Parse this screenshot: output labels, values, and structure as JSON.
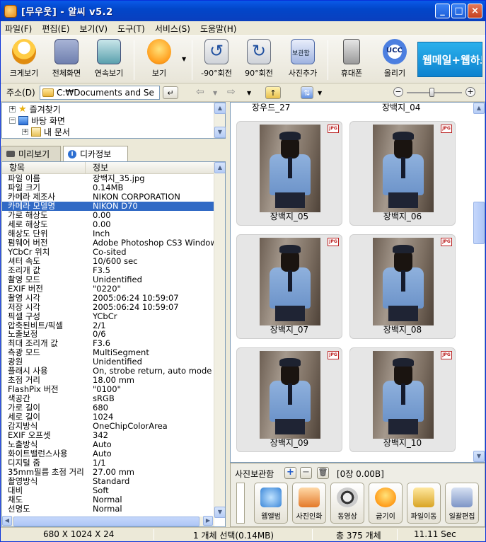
{
  "window": {
    "title": "[무우웃] - 알씨 v5.2",
    "controls": [
      "_",
      "□",
      "×"
    ]
  },
  "menu": [
    "파일(F)",
    "편집(E)",
    "보기(V)",
    "도구(T)",
    "서비스(S)",
    "도움말(H)"
  ],
  "toolbar": {
    "items": [
      {
        "label": "크게보기",
        "icon": "penguin-icon"
      },
      {
        "label": "전체화면",
        "icon": "robot-icon"
      },
      {
        "label": "연속보기",
        "icon": "slideshow-icon"
      },
      {
        "label": "보기",
        "icon": "owl-icon"
      },
      {
        "label": "-90°회전",
        "icon": "rotate-left-icon"
      },
      {
        "label": "90°회전",
        "icon": "rotate-right-icon"
      },
      {
        "label": "사진추가",
        "icon": "album-icon"
      },
      {
        "label": "휴대폰",
        "icon": "phone-icon"
      },
      {
        "label": "올리기",
        "icon": "ucc-icon"
      }
    ],
    "banner": "웹메일+웹하드"
  },
  "address": {
    "label": "주소(D)",
    "value": "C:₩Documents and Se"
  },
  "tree": [
    {
      "label": "즐겨찾기",
      "expander": "+"
    },
    {
      "label": "바탕 화면",
      "expander": "−"
    },
    {
      "label": "내 문서",
      "expander": "+"
    }
  ],
  "tabs": {
    "preview": "미리보기",
    "exif": "디카정보"
  },
  "exif": {
    "headers": [
      "항목",
      "정보"
    ],
    "rows": [
      {
        "k": "파일 이름",
        "v": "장백지_35.jpg"
      },
      {
        "k": "파일 크기",
        "v": "0.14MB"
      },
      {
        "k": "카메라 제조사",
        "v": "NIKON CORPORATION"
      },
      {
        "k": "카메라 모델명",
        "v": "NIKON D70",
        "selected": true
      },
      {
        "k": "가로 해상도",
        "v": "0.00"
      },
      {
        "k": "세로 해상도",
        "v": "0.00"
      },
      {
        "k": "해상도 단위",
        "v": "Inch"
      },
      {
        "k": "펌웨어 버전",
        "v": "Adobe Photoshop CS3 Windows"
      },
      {
        "k": "YCbCr 위치",
        "v": "Co-sited"
      },
      {
        "k": "셔터 속도",
        "v": "10/600 sec"
      },
      {
        "k": "조리개 값",
        "v": "F3.5"
      },
      {
        "k": "촬영 모드",
        "v": "Unidentified"
      },
      {
        "k": "EXIF 버전",
        "v": "\"0220\""
      },
      {
        "k": "촬영 시각",
        "v": "2005:06:24 10:59:07"
      },
      {
        "k": "저장 시각",
        "v": "2005:06:24 10:59:07"
      },
      {
        "k": "픽셀 구성",
        "v": "YCbCr"
      },
      {
        "k": "압축된비트/픽셀",
        "v": "2/1"
      },
      {
        "k": "노출보정",
        "v": "0/6"
      },
      {
        "k": "최대 조리개 값",
        "v": "F3.6"
      },
      {
        "k": "측광 모드",
        "v": "MultiSegment"
      },
      {
        "k": "광원",
        "v": "Unidentified"
      },
      {
        "k": "플래시 사용",
        "v": "On, strobe return, auto mode"
      },
      {
        "k": "초점 거리",
        "v": "18.00 mm"
      },
      {
        "k": "FlashPix 버전",
        "v": "\"0100\""
      },
      {
        "k": "색공간",
        "v": "sRGB"
      },
      {
        "k": "가로 길이",
        "v": "680"
      },
      {
        "k": "세로 길이",
        "v": "1024"
      },
      {
        "k": "감지방식",
        "v": "OneChipColorArea"
      },
      {
        "k": "EXIF 오프셋",
        "v": "342"
      },
      {
        "k": "노출방식",
        "v": "Auto"
      },
      {
        "k": "화이트밸런스사용",
        "v": "Auto"
      },
      {
        "k": "디지털 줌",
        "v": "1/1"
      },
      {
        "k": "35mm필름 초점 거리",
        "v": "27.00 mm"
      },
      {
        "k": "촬영방식",
        "v": "Standard"
      },
      {
        "k": "대비",
        "v": "Soft"
      },
      {
        "k": "채도",
        "v": "Normal"
      },
      {
        "k": "선명도",
        "v": "Normal"
      }
    ]
  },
  "thumbnails": {
    "partial_top": [
      "장우드_27",
      "장백지_04"
    ],
    "items": [
      {
        "caption": "장백지_05",
        "badge": "JPG"
      },
      {
        "caption": "장백지_06",
        "badge": "JPG"
      },
      {
        "caption": "장백지_07",
        "badge": "JPG"
      },
      {
        "caption": "장백지_08",
        "badge": "JPG"
      },
      {
        "caption": "장백지_09",
        "badge": "JPG"
      },
      {
        "caption": "장백지_10",
        "badge": "JPG"
      }
    ]
  },
  "album": {
    "title": "사진보관함",
    "count": "[0장 0.00B]",
    "buttons": [
      "웹앨범",
      "사진인화",
      "동영상",
      "굽기이",
      "파일이동",
      "일괄편집"
    ]
  },
  "status": {
    "dimensions": "680 X 1024 X 24",
    "selection": "1 개체 선택(0.14MB)",
    "total": "총 375 개체",
    "time": "11.11 Sec"
  },
  "colors": {
    "selection": "#316ac5",
    "titlebar": "#0a5ae8"
  }
}
